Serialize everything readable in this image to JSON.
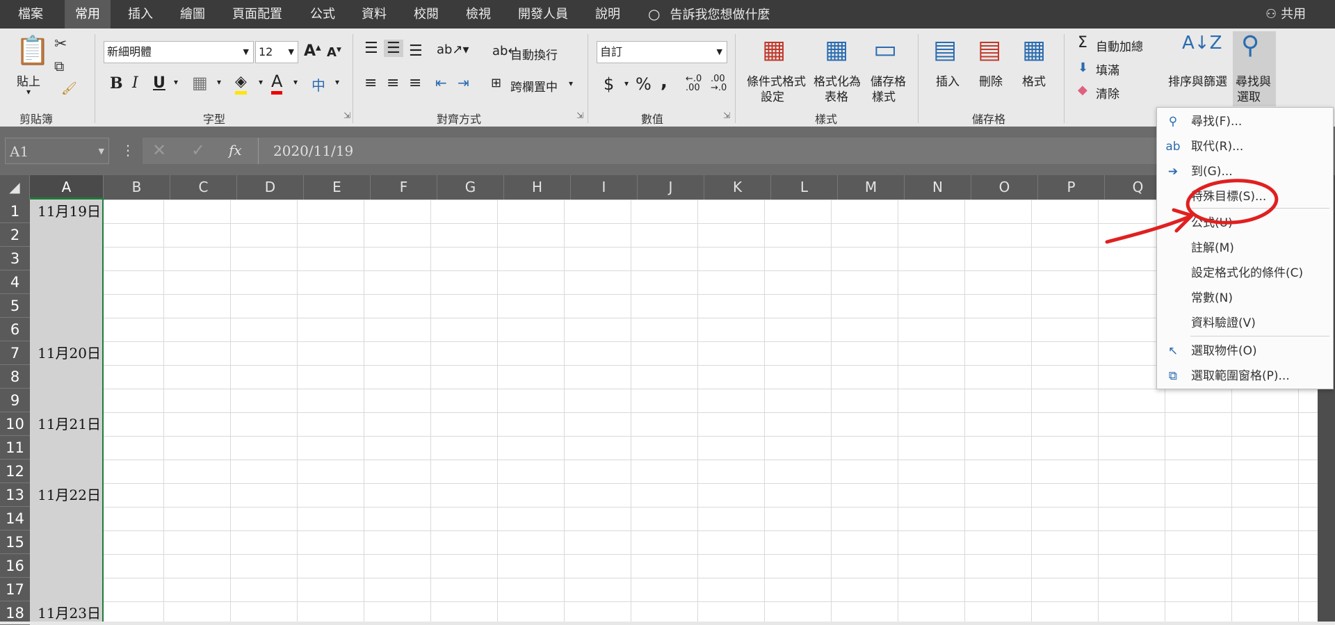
{
  "tabs": [
    "檔案",
    "常用",
    "插入",
    "繪圖",
    "頁面配置",
    "公式",
    "資料",
    "校閱",
    "檢視",
    "開發人員",
    "說明"
  ],
  "active_tab": "常用",
  "tell_me": "告訴我您想做什麼",
  "share": "共用",
  "ribbon": {
    "clipboard": {
      "paste": "貼上",
      "label": "剪貼簿"
    },
    "font": {
      "name": "新細明體",
      "size": "12",
      "label": "字型",
      "bold": "B",
      "italic": "I",
      "underline": "U"
    },
    "alignment": {
      "wrap": "自動換行",
      "merge": "跨欄置中",
      "label": "對齊方式"
    },
    "number": {
      "format": "自訂",
      "label": "數值",
      "currency": "$",
      "percent": "%",
      "comma": ","
    },
    "styles": {
      "cond": "條件式格式",
      "cond2": "設定",
      "table": "格式化為",
      "table2": "表格",
      "cell": "儲存格",
      "cell2": "樣式",
      "label": "樣式"
    },
    "cells": {
      "insert": "插入",
      "delete": "刪除",
      "format": "格式",
      "label": "儲存格"
    },
    "editing": {
      "autosum": "自動加總",
      "fill": "填滿",
      "clear": "清除",
      "sort": "排序與篩選",
      "find": "尋找與",
      "find2": "選取"
    }
  },
  "formula_bar": {
    "name_box": "A1",
    "fx": "fx",
    "value": "2020/11/19"
  },
  "columns": [
    "A",
    "B",
    "C",
    "D",
    "E",
    "F",
    "G",
    "H",
    "I",
    "J",
    "K",
    "L",
    "M",
    "N",
    "O",
    "P",
    "Q"
  ],
  "rows": [
    "1",
    "2",
    "3",
    "4",
    "5",
    "6",
    "7",
    "8",
    "9",
    "10",
    "11",
    "12",
    "13",
    "14",
    "15",
    "16",
    "17",
    "18"
  ],
  "cells": [
    {
      "row": "1",
      "value": "11月19日"
    },
    {
      "row": "7",
      "value": "11月20日"
    },
    {
      "row": "10",
      "value": "11月21日"
    },
    {
      "row": "13",
      "value": "11月22日"
    },
    {
      "row": "18",
      "value": "11月23日"
    }
  ],
  "find_menu": {
    "items": [
      {
        "label": "尋找(F)...",
        "icon": "search-icon"
      },
      {
        "label": "取代(R)...",
        "icon": "replace-icon"
      },
      {
        "label": "到(G)...",
        "icon": "arrow-right-icon"
      },
      {
        "label": "特殊目標(S)...",
        "icon": ""
      },
      {
        "label": "公式(U)",
        "icon": ""
      },
      {
        "label": "註解(M)",
        "icon": ""
      },
      {
        "label": "設定格式化的條件(C)",
        "icon": ""
      },
      {
        "label": "常數(N)",
        "icon": ""
      },
      {
        "label": "資料驗證(V)",
        "icon": ""
      },
      {
        "label": "選取物件(O)",
        "icon": "pointer-icon"
      },
      {
        "label": "選取範圍窗格(P)...",
        "icon": "selection-pane-icon"
      }
    ]
  },
  "colors": {
    "annotation": "#e02020",
    "selected_border": "#1f7a3c",
    "accent": "#2b6cb0"
  }
}
